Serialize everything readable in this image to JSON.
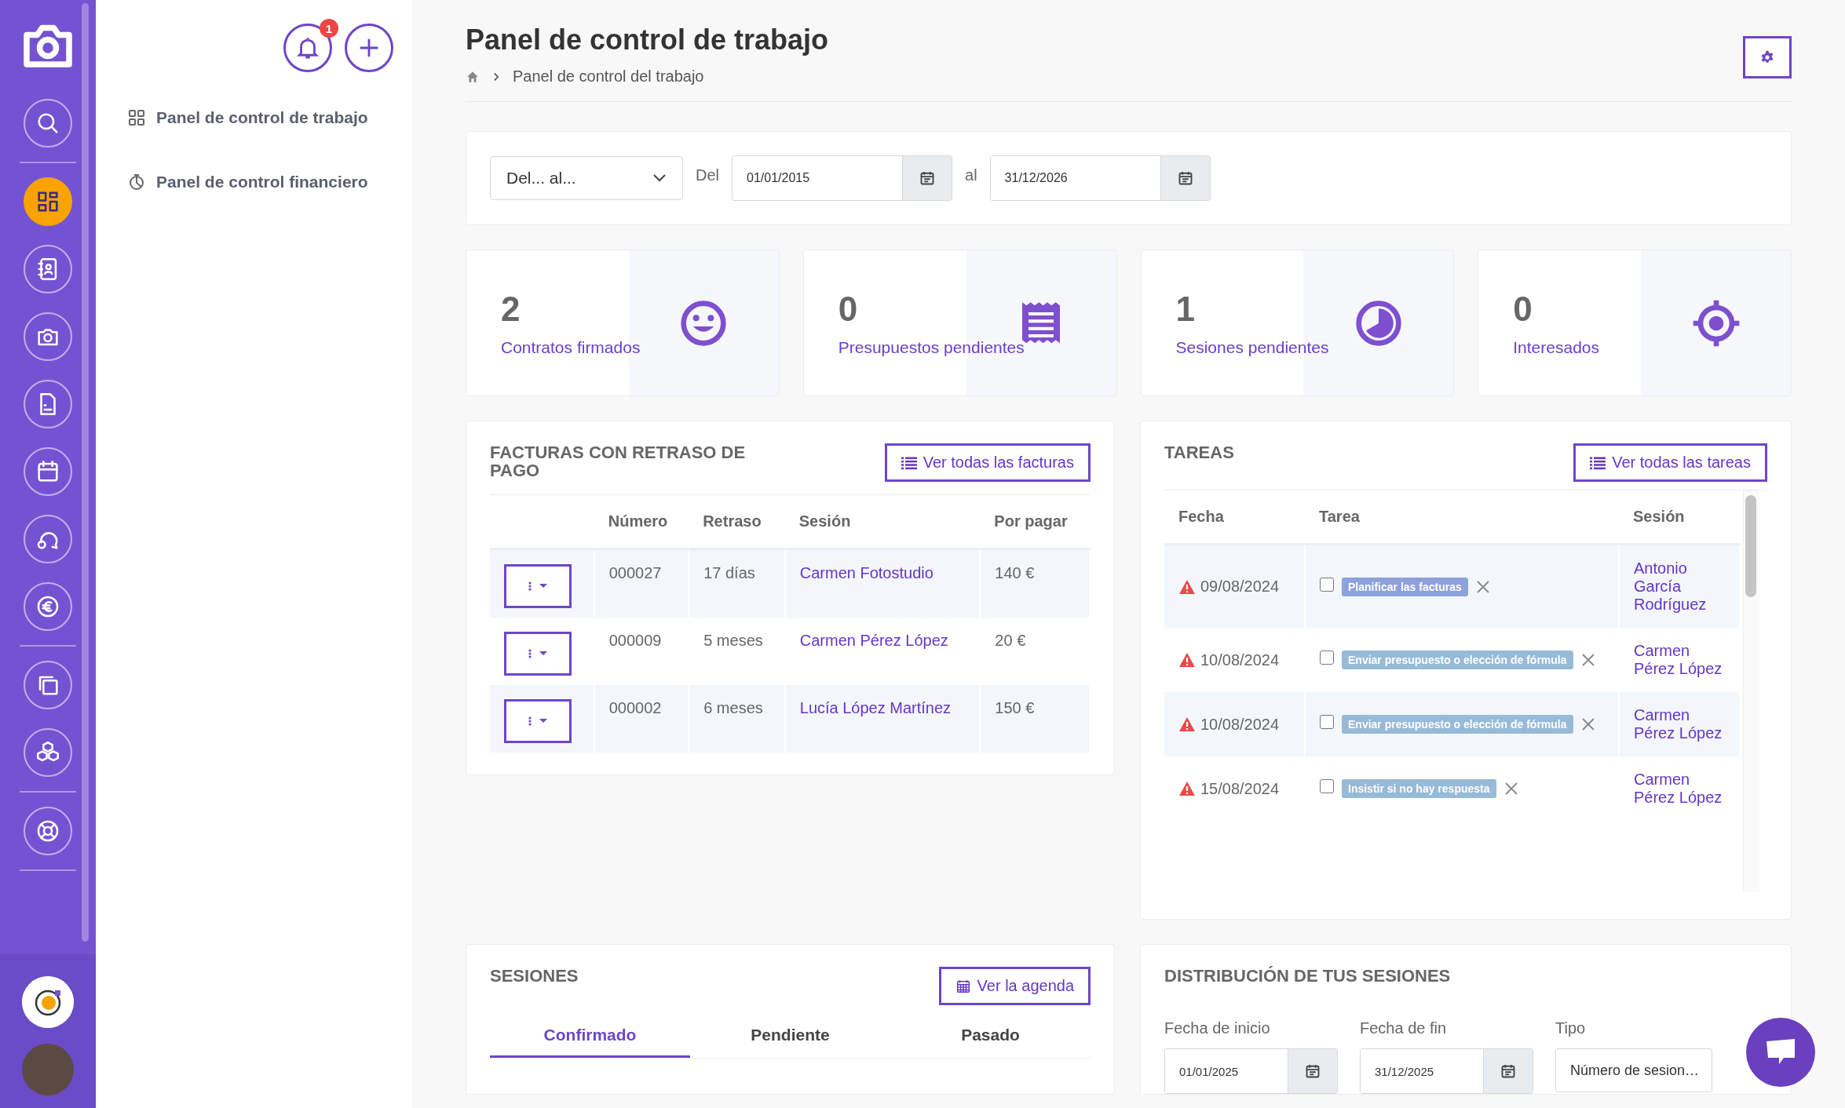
{
  "rail": {
    "groups": [
      [
        {
          "kind": "search",
          "selected": false
        }
      ],
      [
        {
          "kind": "dashboard",
          "selected": true
        },
        {
          "kind": "contacts",
          "selected": false
        },
        {
          "kind": "camera",
          "selected": false
        },
        {
          "kind": "document",
          "selected": false
        },
        {
          "kind": "calendar",
          "selected": false
        },
        {
          "kind": "chat",
          "selected": false
        },
        {
          "kind": "euro",
          "selected": false
        }
      ],
      [
        {
          "kind": "copy",
          "selected": false
        },
        {
          "kind": "cubes",
          "selected": false
        }
      ],
      [
        {
          "kind": "help",
          "selected": false
        }
      ]
    ]
  },
  "subnav": {
    "notification_count": "1",
    "items": [
      {
        "kind": "grid",
        "label": "Panel de control de trabajo"
      },
      {
        "kind": "chart",
        "label": "Panel de control financiero"
      }
    ]
  },
  "page": {
    "title": "Panel de control de trabajo",
    "breadcrumb": "Panel de control del trabajo"
  },
  "filter": {
    "range": "Del... al...",
    "from_label": "Del",
    "from": "01/01/2015",
    "to_label": "al",
    "to": "31/12/2026"
  },
  "kpis": [
    {
      "kind": "smile",
      "value": "2",
      "label": "Contratos firmados"
    },
    {
      "kind": "receipt",
      "value": "0",
      "label": "Presupuestos pendientes"
    },
    {
      "kind": "pie",
      "value": "1",
      "label": "Sesiones pendientes"
    },
    {
      "kind": "target",
      "value": "0",
      "label": "Interesados"
    }
  ],
  "invoices": {
    "title": "FACTURAS CON RETRASO DE PAGO",
    "button": "Ver todas las facturas",
    "columns": [
      "Número",
      "Retraso",
      "Sesión",
      "Por pagar"
    ],
    "rows": [
      {
        "number": "000027",
        "delay": "17 días",
        "session": "Carmen Fotostudio",
        "amount": "140 €"
      },
      {
        "number": "000009",
        "delay": "5 meses",
        "session": "Carmen Pérez López",
        "amount": "20 €"
      },
      {
        "number": "000002",
        "delay": "6 meses",
        "session": "Lucía López Martínez",
        "amount": "150 €"
      }
    ]
  },
  "tasks": {
    "title": "TAREAS",
    "button": "Ver todas las tareas",
    "columns": [
      "Fecha",
      "Tarea",
      "Sesión"
    ],
    "rows": [
      {
        "date": "09/08/2024",
        "task": "Planificar las facturas",
        "color": "#8da2dc",
        "checked": false,
        "session": "Antonio García Rodríguez"
      },
      {
        "date": "10/08/2024",
        "task": "Enviar presupuesto o elección de fórmula",
        "color": "#97bad8",
        "checked": false,
        "session": "Carmen Pérez López"
      },
      {
        "date": "10/08/2024",
        "task": "Enviar presupuesto o elección de fórmula",
        "color": "#97bad8",
        "checked": false,
        "session": "Carmen Pérez López"
      },
      {
        "date": "15/08/2024",
        "task": "Insistir si no hay respuesta",
        "color": "#97bad8",
        "checked": false,
        "session": "Carmen Pérez López"
      }
    ]
  },
  "sessions": {
    "title": "SESIONES",
    "button": "Ver la agenda",
    "tabs": [
      {
        "label": "Confirmado",
        "selected": true
      },
      {
        "label": "Pendiente",
        "selected": false
      },
      {
        "label": "Pasado",
        "selected": false
      }
    ]
  },
  "distribution": {
    "title": "DISTRIBUCIÓN DE TUS SESIONES",
    "fields": [
      {
        "kind": "date",
        "label": "Fecha de inicio",
        "value": "01/01/2025"
      },
      {
        "kind": "date",
        "label": "Fecha de fin",
        "value": "31/12/2025"
      },
      {
        "kind": "select",
        "label": "Tipo",
        "value": "Número de sesion…"
      }
    ]
  }
}
